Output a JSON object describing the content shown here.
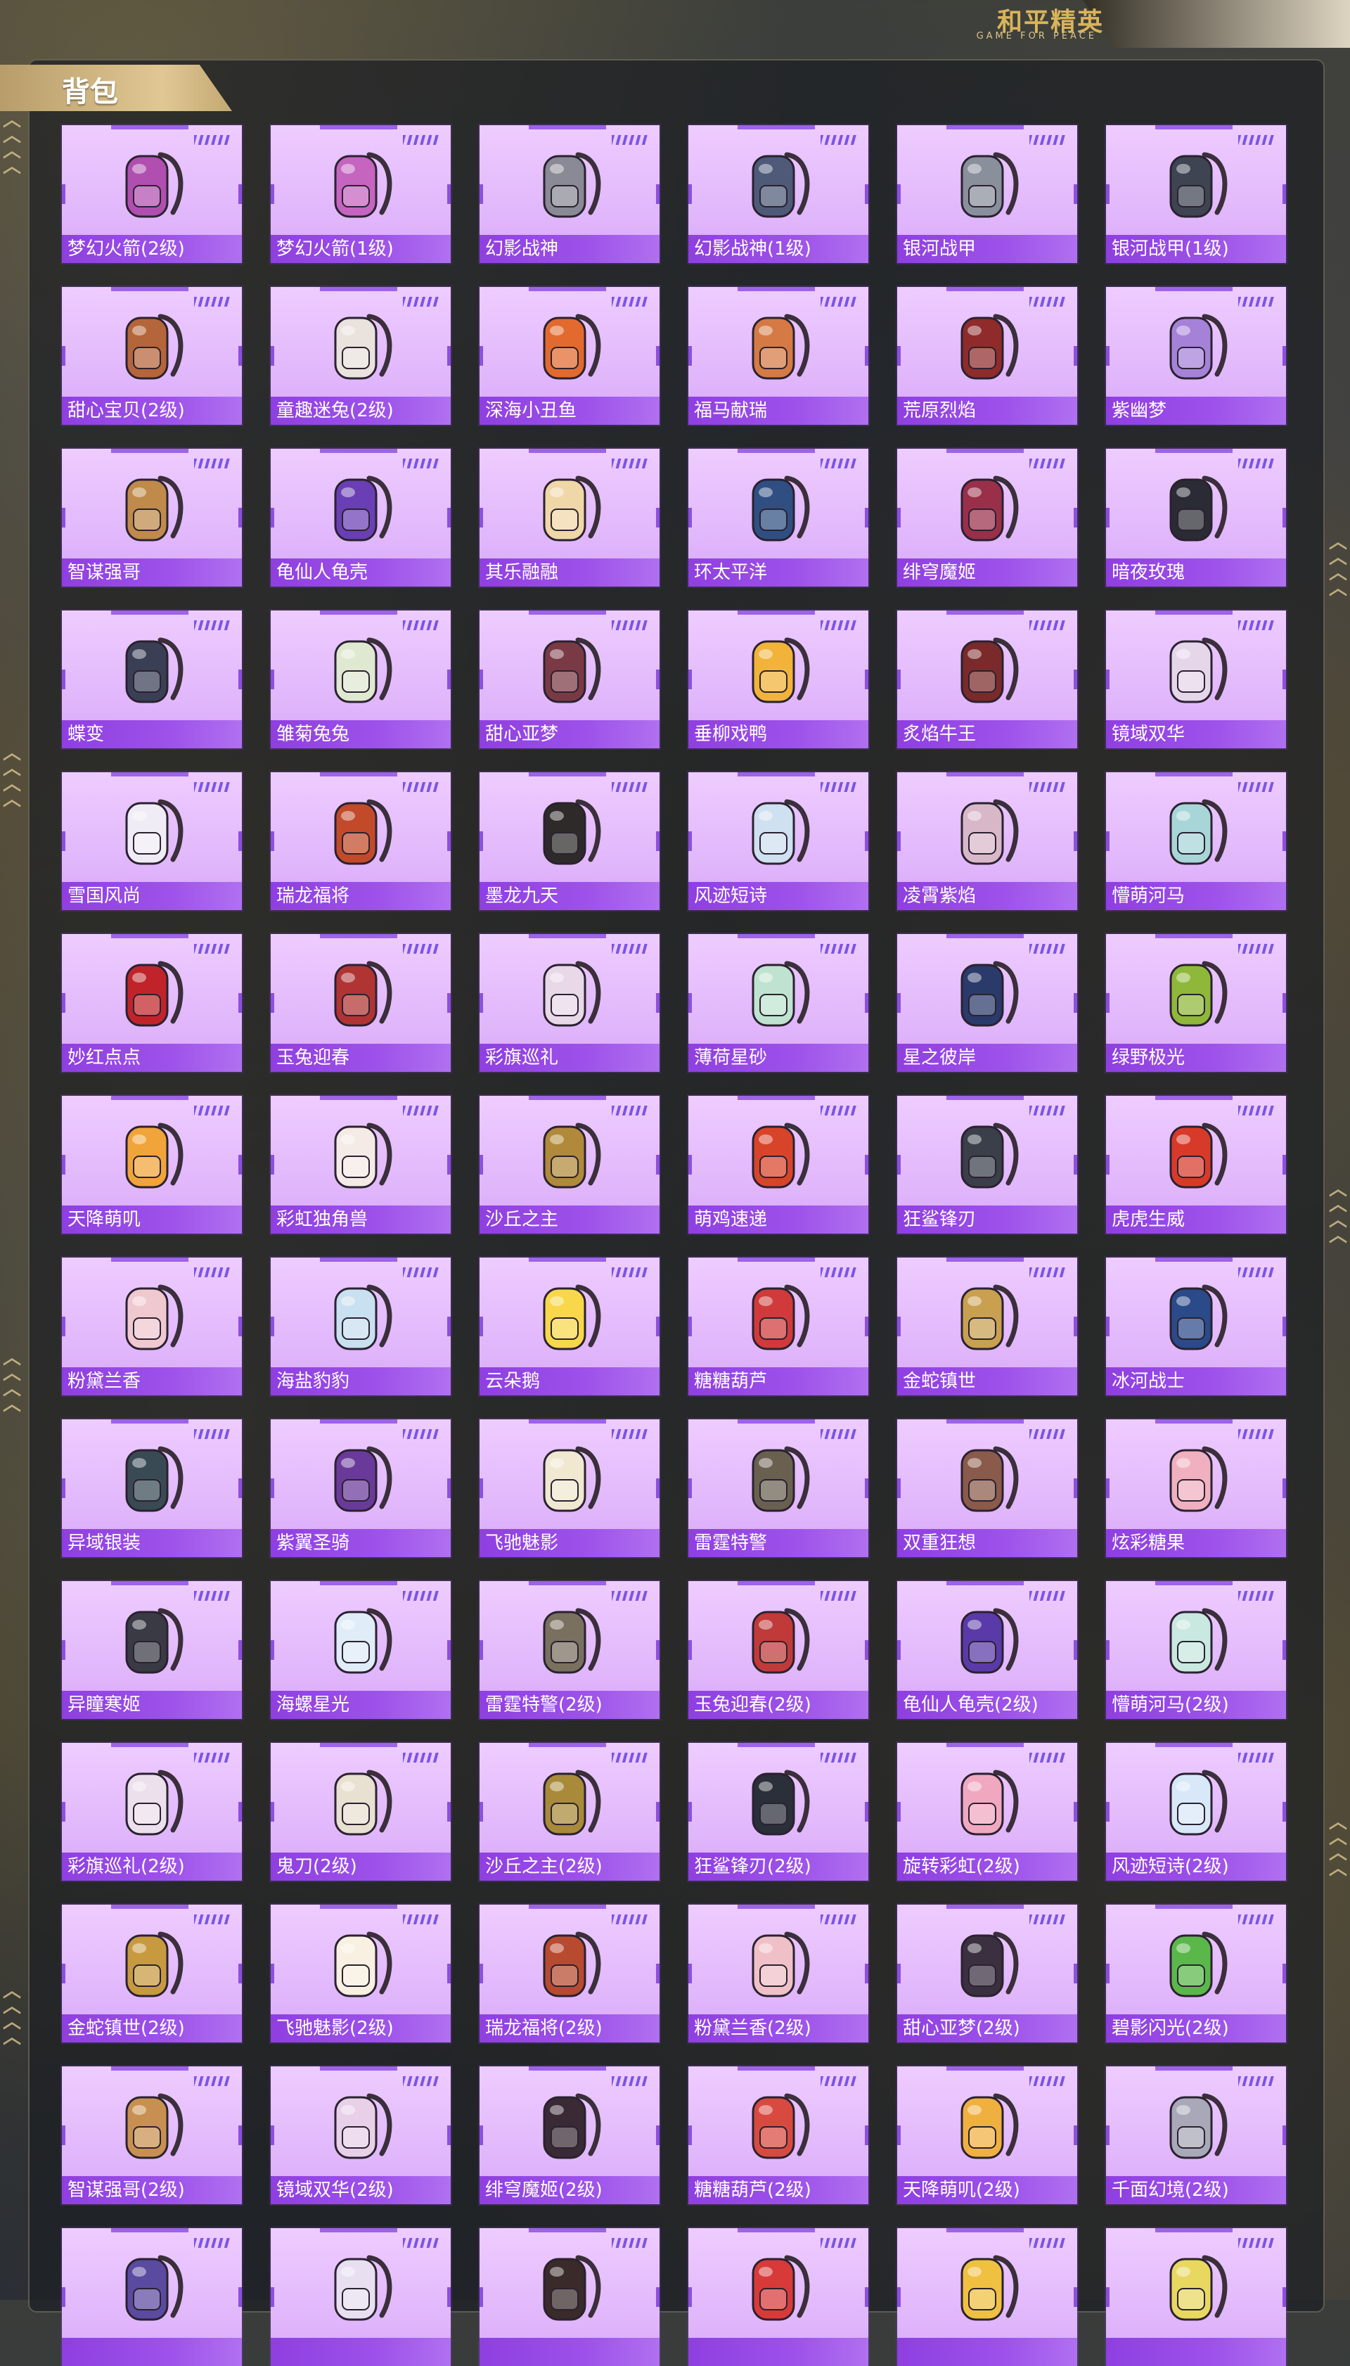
{
  "header": {
    "logo_title": "和平精英",
    "logo_subtitle": "GAME FOR PEACE"
  },
  "section": {
    "title": "背包"
  },
  "items": [
    {
      "name": "梦幻火箭(2级)",
      "color": "#b04fb0"
    },
    {
      "name": "梦幻火箭(1级)",
      "color": "#c565c0"
    },
    {
      "name": "幻影战神",
      "color": "#8a8a96"
    },
    {
      "name": "幻影战神(1级)",
      "color": "#4e5a78"
    },
    {
      "name": "银河战甲",
      "color": "#8a8f9c"
    },
    {
      "name": "银河战甲(1级)",
      "color": "#3e4452"
    },
    {
      "name": "甜心宝贝(2级)",
      "color": "#b5653a"
    },
    {
      "name": "童趣迷兔(2级)",
      "color": "#e9e2dd"
    },
    {
      "name": "深海小丑鱼",
      "color": "#e26a2f"
    },
    {
      "name": "福马献瑞",
      "color": "#d57a45"
    },
    {
      "name": "荒原烈焰",
      "color": "#8f2b2b"
    },
    {
      "name": "紫幽梦",
      "color": "#a582d8"
    },
    {
      "name": "智谋强哥",
      "color": "#c08a4a"
    },
    {
      "name": "龟仙人龟壳",
      "color": "#6a3fb5"
    },
    {
      "name": "其乐融融",
      "color": "#f0d7a8"
    },
    {
      "name": "环太平洋",
      "color": "#2f4f82"
    },
    {
      "name": "绯穹魔姬",
      "color": "#9a2f4a"
    },
    {
      "name": "暗夜玫瑰",
      "color": "#2b2b35"
    },
    {
      "name": "蝶变",
      "color": "#3a3f55"
    },
    {
      "name": "雏菊兔兔",
      "color": "#dfe8d0"
    },
    {
      "name": "甜心亚梦",
      "color": "#7a3a45"
    },
    {
      "name": "垂柳戏鸭",
      "color": "#f2b33a"
    },
    {
      "name": "炙焰牛王",
      "color": "#7a2a2a"
    },
    {
      "name": "镜域双华",
      "color": "#e6d6ea"
    },
    {
      "name": "雪国风尚",
      "color": "#f0ecf5"
    },
    {
      "name": "瑞龙福将",
      "color": "#c24a2a"
    },
    {
      "name": "墨龙九天",
      "color": "#2f2a2a"
    },
    {
      "name": "风迹短诗",
      "color": "#cfe0f0"
    },
    {
      "name": "凌霄紫焰",
      "color": "#d8b8c8"
    },
    {
      "name": "懵萌河马",
      "color": "#a8d6d8"
    },
    {
      "name": "妙红点点",
      "color": "#c0242a"
    },
    {
      "name": "玉兔迎春",
      "color": "#b03434"
    },
    {
      "name": "彩旗巡礼",
      "color": "#e8d8e8"
    },
    {
      "name": "薄荷星砂",
      "color": "#bfe3d0"
    },
    {
      "name": "星之彼岸",
      "color": "#2a3a6a"
    },
    {
      "name": "绿野极光",
      "color": "#8fb83a"
    },
    {
      "name": "天降萌叽",
      "color": "#f0a43a"
    },
    {
      "name": "彩虹独角兽",
      "color": "#f5ebe6"
    },
    {
      "name": "沙丘之主",
      "color": "#b08a3a"
    },
    {
      "name": "萌鸡速递",
      "color": "#d8442a"
    },
    {
      "name": "狂鲨锋刃",
      "color": "#3a3f4a"
    },
    {
      "name": "虎虎生威",
      "color": "#d83a2a"
    },
    {
      "name": "粉黛兰香",
      "color": "#f0c8d0"
    },
    {
      "name": "海盐豹豹",
      "color": "#c8e0f0"
    },
    {
      "name": "云朵鹅",
      "color": "#f8d84a"
    },
    {
      "name": "糖糖葫芦",
      "color": "#d03a3a"
    },
    {
      "name": "金蛇镇世",
      "color": "#c8a050"
    },
    {
      "name": "冰河战士",
      "color": "#2a4a8a"
    },
    {
      "name": "异域银装",
      "color": "#3a4a55"
    },
    {
      "name": "紫翼圣骑",
      "color": "#6a3a9a"
    },
    {
      "name": "飞驰魅影",
      "color": "#f0e8d0"
    },
    {
      "name": "雷霆特警",
      "color": "#6a6050"
    },
    {
      "name": "双重狂想",
      "color": "#8a5a4a"
    },
    {
      "name": "炫彩糖果",
      "color": "#f0b0c0"
    },
    {
      "name": "异瞳寒姬",
      "color": "#3a3a45"
    },
    {
      "name": "海螺星光",
      "color": "#e0ecf8"
    },
    {
      "name": "雷霆特警(2级)",
      "color": "#7a7060"
    },
    {
      "name": "玉兔迎春(2级)",
      "color": "#c03a3a"
    },
    {
      "name": "龟仙人龟壳(2级)",
      "color": "#5a3aa8"
    },
    {
      "name": "懵萌河马(2级)",
      "color": "#c8e8e0"
    },
    {
      "name": "彩旗巡礼(2级)",
      "color": "#ece0ec"
    },
    {
      "name": "鬼刀(2级)",
      "color": "#e8e0d0"
    },
    {
      "name": "沙丘之主(2级)",
      "color": "#a88a3a"
    },
    {
      "name": "狂鲨锋刃(2级)",
      "color": "#2a2f3a"
    },
    {
      "name": "旋转彩虹(2级)",
      "color": "#f0a8c0"
    },
    {
      "name": "风迹短诗(2级)",
      "color": "#d8e8f8"
    },
    {
      "name": "金蛇镇世(2级)",
      "color": "#c89a40"
    },
    {
      "name": "飞驰魅影(2级)",
      "color": "#f8f0e0"
    },
    {
      "name": "瑞龙福将(2级)",
      "color": "#b84a30"
    },
    {
      "name": "粉黛兰香(2级)",
      "color": "#f0c0c8"
    },
    {
      "name": "甜心亚梦(2级)",
      "color": "#3a3040"
    },
    {
      "name": "碧影闪光(2级)",
      "color": "#5ab84a"
    },
    {
      "name": "智谋强哥(2级)",
      "color": "#c89050"
    },
    {
      "name": "镜域双华(2级)",
      "color": "#e8d0e8"
    },
    {
      "name": "绯穹魔姬(2级)",
      "color": "#3a2a35"
    },
    {
      "name": "糖糖葫芦(2级)",
      "color": "#d84a40"
    },
    {
      "name": "天降萌叽(2级)",
      "color": "#f0b040"
    },
    {
      "name": "千面幻境(2级)",
      "color": "#a8a8b8"
    },
    {
      "name": "",
      "color": "#5a4aa0"
    },
    {
      "name": "",
      "color": "#e8e0f0"
    },
    {
      "name": "",
      "color": "#3a2a2a"
    },
    {
      "name": "",
      "color": "#d83a3a"
    },
    {
      "name": "",
      "color": "#f0c040"
    },
    {
      "name": "",
      "color": "#e8d860"
    }
  ]
}
